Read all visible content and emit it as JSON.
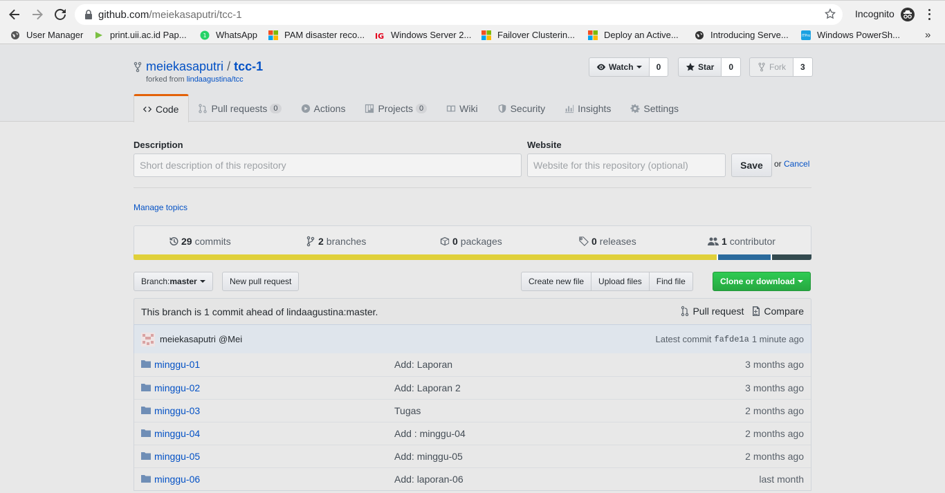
{
  "browser": {
    "url_host": "github.com",
    "url_path": "/meiekasaputri/tcc-1",
    "incognito_label": "Incognito",
    "bookmarks": [
      {
        "label": "User Manager",
        "icon": "globe-icon",
        "color": "#555555"
      },
      {
        "label": "print.uii.ac.id Pap...",
        "icon": "print-icon",
        "color": "#7bc043"
      },
      {
        "label": "WhatsApp",
        "icon": "whatsapp-icon",
        "color": "#25d366"
      },
      {
        "label": "PAM disaster reco...",
        "icon": "microsoft-icon",
        "color": "#f25022"
      },
      {
        "label": "Windows Server 2...",
        "icon": "ig-icon",
        "color": "#e3001b"
      },
      {
        "label": "Failover Clusterin...",
        "icon": "microsoft-icon",
        "color": "#f25022"
      },
      {
        "label": "Deploy an Active...",
        "icon": "microsoft-icon",
        "color": "#f25022"
      },
      {
        "label": "Introducing Serve...",
        "icon": "globe-icon",
        "color": "#333333"
      },
      {
        "label": "Windows PowerSh...",
        "icon": "itpro-icon",
        "color": "#1ba1e2"
      }
    ],
    "more_label": "»"
  },
  "repo": {
    "owner": "meiekasaputri",
    "separator": "/",
    "name": "tcc-1",
    "forked_prefix": "forked from ",
    "forked_source": "lindaagustina/tcc",
    "watch_label": "Watch",
    "watch_count": "0",
    "star_label": "Star",
    "star_count": "0",
    "fork_label": "Fork",
    "fork_count": "3"
  },
  "tabs": [
    {
      "label": "Code",
      "counter": "",
      "icon": "code-icon"
    },
    {
      "label": "Pull requests",
      "counter": "0",
      "icon": "pull-request-icon"
    },
    {
      "label": "Actions",
      "counter": "",
      "icon": "play-icon"
    },
    {
      "label": "Projects",
      "counter": "0",
      "icon": "project-icon"
    },
    {
      "label": "Wiki",
      "counter": "",
      "icon": "book-icon"
    },
    {
      "label": "Security",
      "counter": "",
      "icon": "shield-icon"
    },
    {
      "label": "Insights",
      "counter": "",
      "icon": "graph-icon"
    },
    {
      "label": "Settings",
      "counter": "",
      "icon": "gear-icon"
    }
  ],
  "edit": {
    "description_label": "Description",
    "description_placeholder": "Short description of this repository",
    "website_label": "Website",
    "website_placeholder": "Website for this repository (optional)",
    "save_label": "Save",
    "or_text": "or ",
    "cancel_label": "Cancel",
    "manage_topics": "Manage topics"
  },
  "summary": {
    "commits_count": "29",
    "commits_label": "commits",
    "branches_count": "2",
    "branches_label": "branches",
    "packages_count": "0",
    "packages_label": "packages",
    "releases_count": "0",
    "releases_label": "releases",
    "contributors_count": "1",
    "contributors_label": "contributor"
  },
  "languages": [
    {
      "color": "#e0d03a",
      "share": 86
    },
    {
      "color": "#2b6a9c",
      "share": 8
    },
    {
      "color": "#334a4f",
      "share": 6
    }
  ],
  "toolbar": {
    "branch_prefix": "Branch: ",
    "branch_name": "master",
    "new_pull_request": "New pull request",
    "create_new_file": "Create new file",
    "upload_files": "Upload files",
    "find_file": "Find file",
    "clone_or_download": "Clone or download"
  },
  "infobar": {
    "text": "This branch is 1 commit ahead of lindaagustina:master.",
    "pull_request": "Pull request",
    "compare": "Compare"
  },
  "latest_commit": {
    "author": "meiekasaputri",
    "message": "@Mei",
    "prefix": "Latest commit",
    "sha": "fafde1a",
    "time": "1 minute ago"
  },
  "files": [
    {
      "name": "minggu-01",
      "message": "Add: Laporan",
      "age": "3 months ago"
    },
    {
      "name": "minggu-02",
      "message": "Add: Laporan 2",
      "age": "3 months ago"
    },
    {
      "name": "minggu-03",
      "message": "Tugas",
      "age": "2 months ago"
    },
    {
      "name": "minggu-04",
      "message": "Add : minggu-04",
      "age": "2 months ago"
    },
    {
      "name": "minggu-05",
      "message": "Add: minggu-05",
      "age": "2 months ago"
    },
    {
      "name": "minggu-06",
      "message": "Add: laporan-06",
      "age": "last month"
    }
  ]
}
